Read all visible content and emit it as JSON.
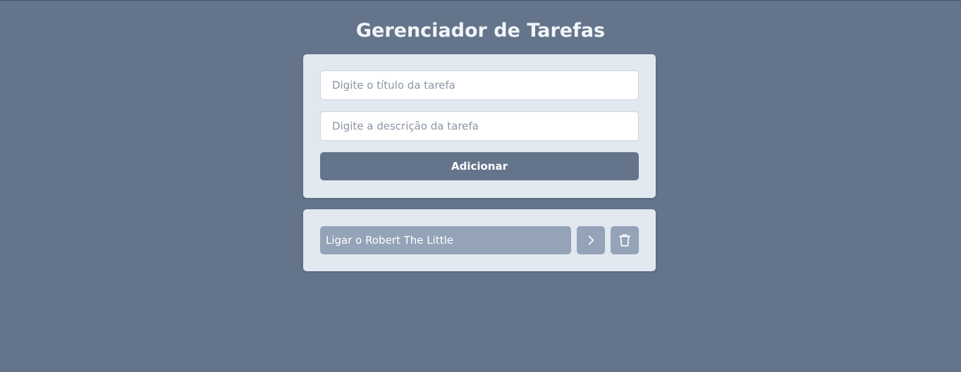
{
  "page": {
    "title": "Gerenciador de Tarefas"
  },
  "form": {
    "title_placeholder": "Digite o título da tarefa",
    "title_value": "",
    "description_placeholder": "Digite a descrição da tarefa",
    "description_value": "",
    "add_label": "Adicionar"
  },
  "tasks": [
    {
      "title": "Ligar o Robert The Little",
      "details_icon": "chevron-right-icon",
      "delete_icon": "trash-icon"
    }
  ],
  "colors": {
    "background": "#64748b",
    "card": "#e2e8f0",
    "button": "#64748b",
    "task_item": "#94a3b8",
    "text_light": "#ffffff"
  }
}
